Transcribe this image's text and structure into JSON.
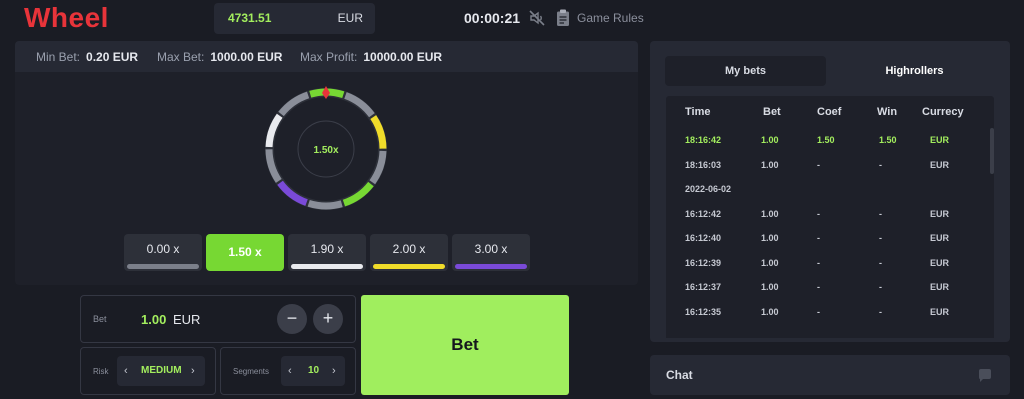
{
  "header": {
    "logo": "Wheel",
    "balance": {
      "value": "4731.51",
      "currency": "EUR"
    },
    "timer": "00:00:21",
    "mute_icon": "sound-off-icon",
    "rules_icon": "clipboard-icon",
    "game_rules_label": "Game Rules"
  },
  "limits": {
    "min_bet_label": "Min Bet:",
    "min_bet_value": "0.20 EUR",
    "max_bet_label": "Max Bet:",
    "max_bet_value": "1000.00 EUR",
    "max_profit_label": "Max Profit:",
    "max_profit_value": "10000.00 EUR"
  },
  "wheel": {
    "center_value": "1.50x",
    "segments": [
      "#77d833",
      "#8a8e99",
      "#f0dc2a",
      "#8a8e99",
      "#77d833",
      "#8a8e99",
      "#7a4ad8",
      "#8a8e99",
      "#e9eaee",
      "#8a8e99"
    ],
    "pointer_color": "#e8343a"
  },
  "multipliers": [
    {
      "label": "0.00 x",
      "color": "#7b7f8a",
      "active": false
    },
    {
      "label": "1.50 x",
      "color": "#77d833",
      "active": true
    },
    {
      "label": "1.90 x",
      "color": "#e9eaee",
      "active": false
    },
    {
      "label": "2.00 x",
      "color": "#f0dc2a",
      "active": false
    },
    {
      "label": "3.00 x",
      "color": "#7a4ad8",
      "active": false
    }
  ],
  "bet": {
    "label": "Bet",
    "amount": "1.00",
    "currency": "EUR",
    "minus": "−",
    "plus": "+",
    "button_label": "Bet"
  },
  "risk": {
    "label": "Risk",
    "value": "MEDIUM",
    "prev": "‹",
    "next": "›"
  },
  "segments": {
    "label": "Segments",
    "value": "10",
    "prev": "‹",
    "next": "›"
  },
  "tabs": {
    "my_bets": "My bets",
    "highrollers": "Highrollers"
  },
  "table": {
    "headers": [
      "Time",
      "Bet",
      "Coef",
      "Win",
      "Currecy"
    ],
    "rows": [
      {
        "time": "18:16:42",
        "bet": "1.00",
        "coef": "1.50",
        "win": "1.50",
        "currency": "EUR",
        "highlight": true
      },
      {
        "time": "18:16:03",
        "bet": "1.00",
        "coef": "-",
        "win": "-",
        "currency": "EUR",
        "highlight": false
      },
      {
        "time": "2022-06-02",
        "bet": "",
        "coef": "",
        "win": "",
        "currency": "",
        "highlight": false
      },
      {
        "time": "16:12:42",
        "bet": "1.00",
        "coef": "-",
        "win": "-",
        "currency": "EUR",
        "highlight": false
      },
      {
        "time": "16:12:40",
        "bet": "1.00",
        "coef": "-",
        "win": "-",
        "currency": "EUR",
        "highlight": false
      },
      {
        "time": "16:12:39",
        "bet": "1.00",
        "coef": "-",
        "win": "-",
        "currency": "EUR",
        "highlight": false
      },
      {
        "time": "16:12:37",
        "bet": "1.00",
        "coef": "-",
        "win": "-",
        "currency": "EUR",
        "highlight": false
      },
      {
        "time": "16:12:35",
        "bet": "1.00",
        "coef": "-",
        "win": "-",
        "currency": "EUR",
        "highlight": false
      }
    ]
  },
  "chat": {
    "label": "Chat",
    "icon": "chat-bubble-icon"
  },
  "colors": {
    "accent_green": "#a0ee5e",
    "brand_red": "#e8343a"
  }
}
